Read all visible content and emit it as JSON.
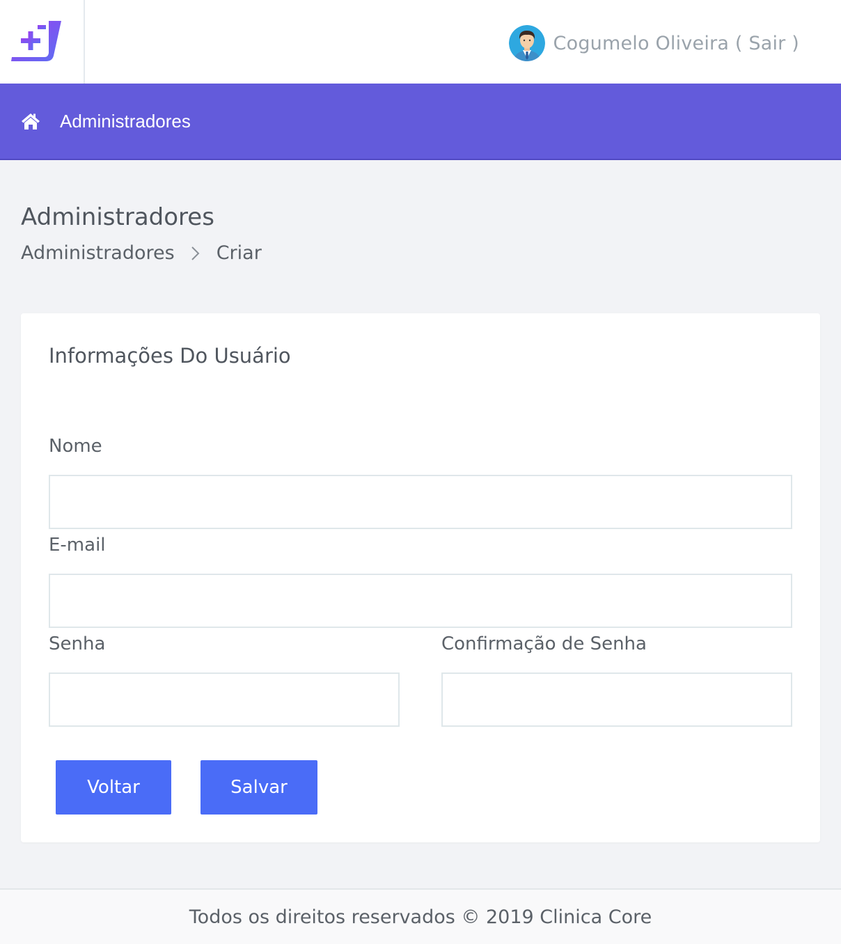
{
  "header": {
    "user_name": "Cogumelo Oliveira",
    "logout_label": "( Sair )"
  },
  "nav": {
    "label": "Administradores"
  },
  "page": {
    "title": "Administradores",
    "breadcrumb": [
      "Administradores",
      "Criar"
    ]
  },
  "form": {
    "section_title": "Informações Do Usuário",
    "fields": {
      "name": {
        "label": "Nome",
        "value": ""
      },
      "email": {
        "label": "E-mail",
        "value": ""
      },
      "password": {
        "label": "Senha",
        "value": ""
      },
      "password_confirmation": {
        "label": "Confirmação de Senha",
        "value": ""
      }
    },
    "buttons": {
      "back": "Voltar",
      "save": "Salvar"
    }
  },
  "footer": {
    "text": "Todos os direitos reservados © 2019 Clinica Core"
  },
  "colors": {
    "navbar": "#635bdb",
    "primary_button": "#4a6cf7",
    "logo_gradient_start": "#8a3df0",
    "logo_gradient_end": "#5b6ff2"
  }
}
